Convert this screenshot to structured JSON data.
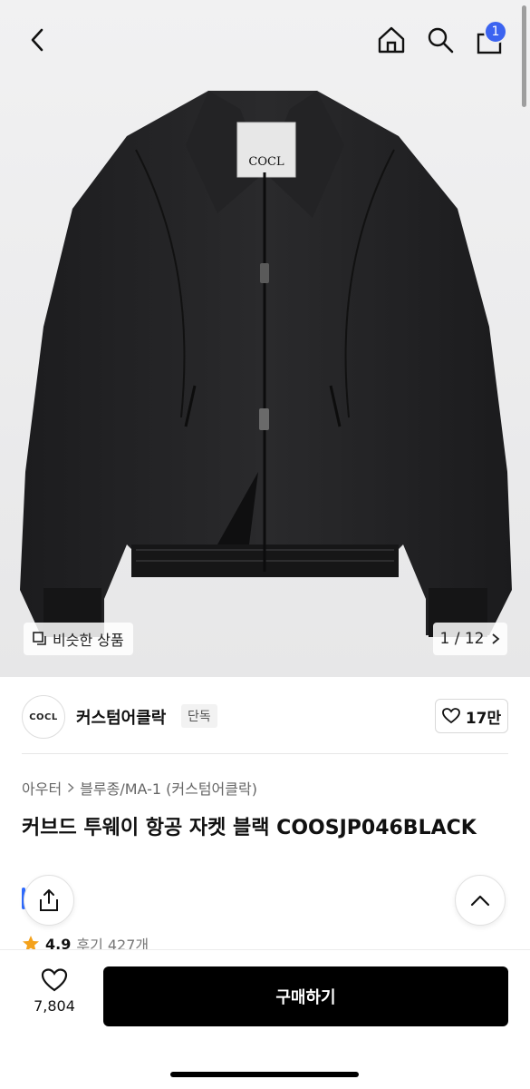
{
  "header": {
    "back_icon": "chevron-left-icon",
    "home_icon": "home-icon",
    "search_icon": "search-icon",
    "bag_icon": "shopping-bag-icon",
    "bag_badge": "1",
    "badge_color": "#3b63f0"
  },
  "gallery": {
    "image_label": "COCL",
    "similar_label": "비슷한 상품",
    "counter": "1 / 12",
    "next_icon": "chevron-right-icon"
  },
  "brand": {
    "logo_text": "COCL",
    "name": "커스텀어클락",
    "tag": "단독",
    "likes": "17만"
  },
  "product": {
    "breadcrumb_1": "아우터",
    "breadcrumb_2": "블루종/MA-1 (커스텀어클락)",
    "title": "커브드 투웨이 항공 자켓 블랙 COOSJP046BLACK",
    "rating": "4.9",
    "reviews": "후기 427개"
  },
  "actions": {
    "wish_count": "7,804",
    "buy_label": "구매하기"
  }
}
